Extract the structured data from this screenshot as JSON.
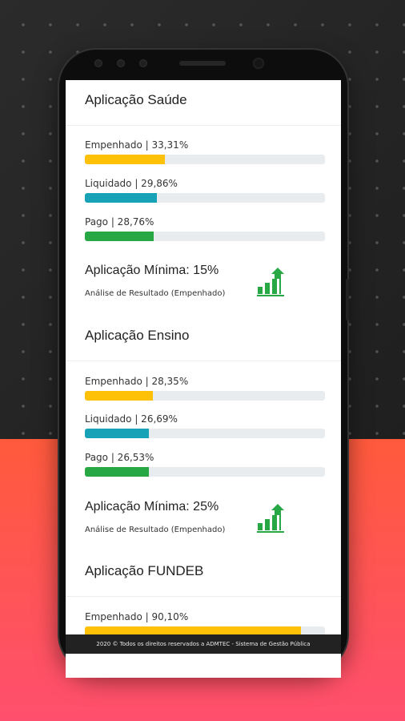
{
  "colors": {
    "empenhado": "#ffc107",
    "liquidado": "#17a2b8",
    "pago": "#28a745",
    "icon": "#28a745"
  },
  "sections": [
    {
      "title": "Aplicação Saúde",
      "metrics": [
        {
          "label": "Empenhado | 33,31%",
          "value": 33.31
        },
        {
          "label": "Liquidado | 29,86%",
          "value": 29.86
        },
        {
          "label": "Pago | 28,76%",
          "value": 28.76
        }
      ],
      "minimo": {
        "title": "Aplicação Mínima: 15%",
        "subtitle": "Análise de Resultado (Empenhado)",
        "icon": "growth-chart-icon"
      }
    },
    {
      "title": "Aplicação Ensino",
      "metrics": [
        {
          "label": "Empenhado | 28,35%",
          "value": 28.35
        },
        {
          "label": "Liquidado | 26,69%",
          "value": 26.69
        },
        {
          "label": "Pago | 26,53%",
          "value": 26.53
        }
      ],
      "minimo": {
        "title": "Aplicação Mínima: 25%",
        "subtitle": "Análise de Resultado (Empenhado)",
        "icon": "growth-chart-icon"
      }
    },
    {
      "title": "Aplicação FUNDEB",
      "metrics": [
        {
          "label": "Empenhado | 90,10%",
          "value": 90.1
        }
      ]
    }
  ],
  "footer": {
    "text": "2020 © Todos os direitos reservados a ADMTEC - Sistema de Gestão Pública"
  }
}
